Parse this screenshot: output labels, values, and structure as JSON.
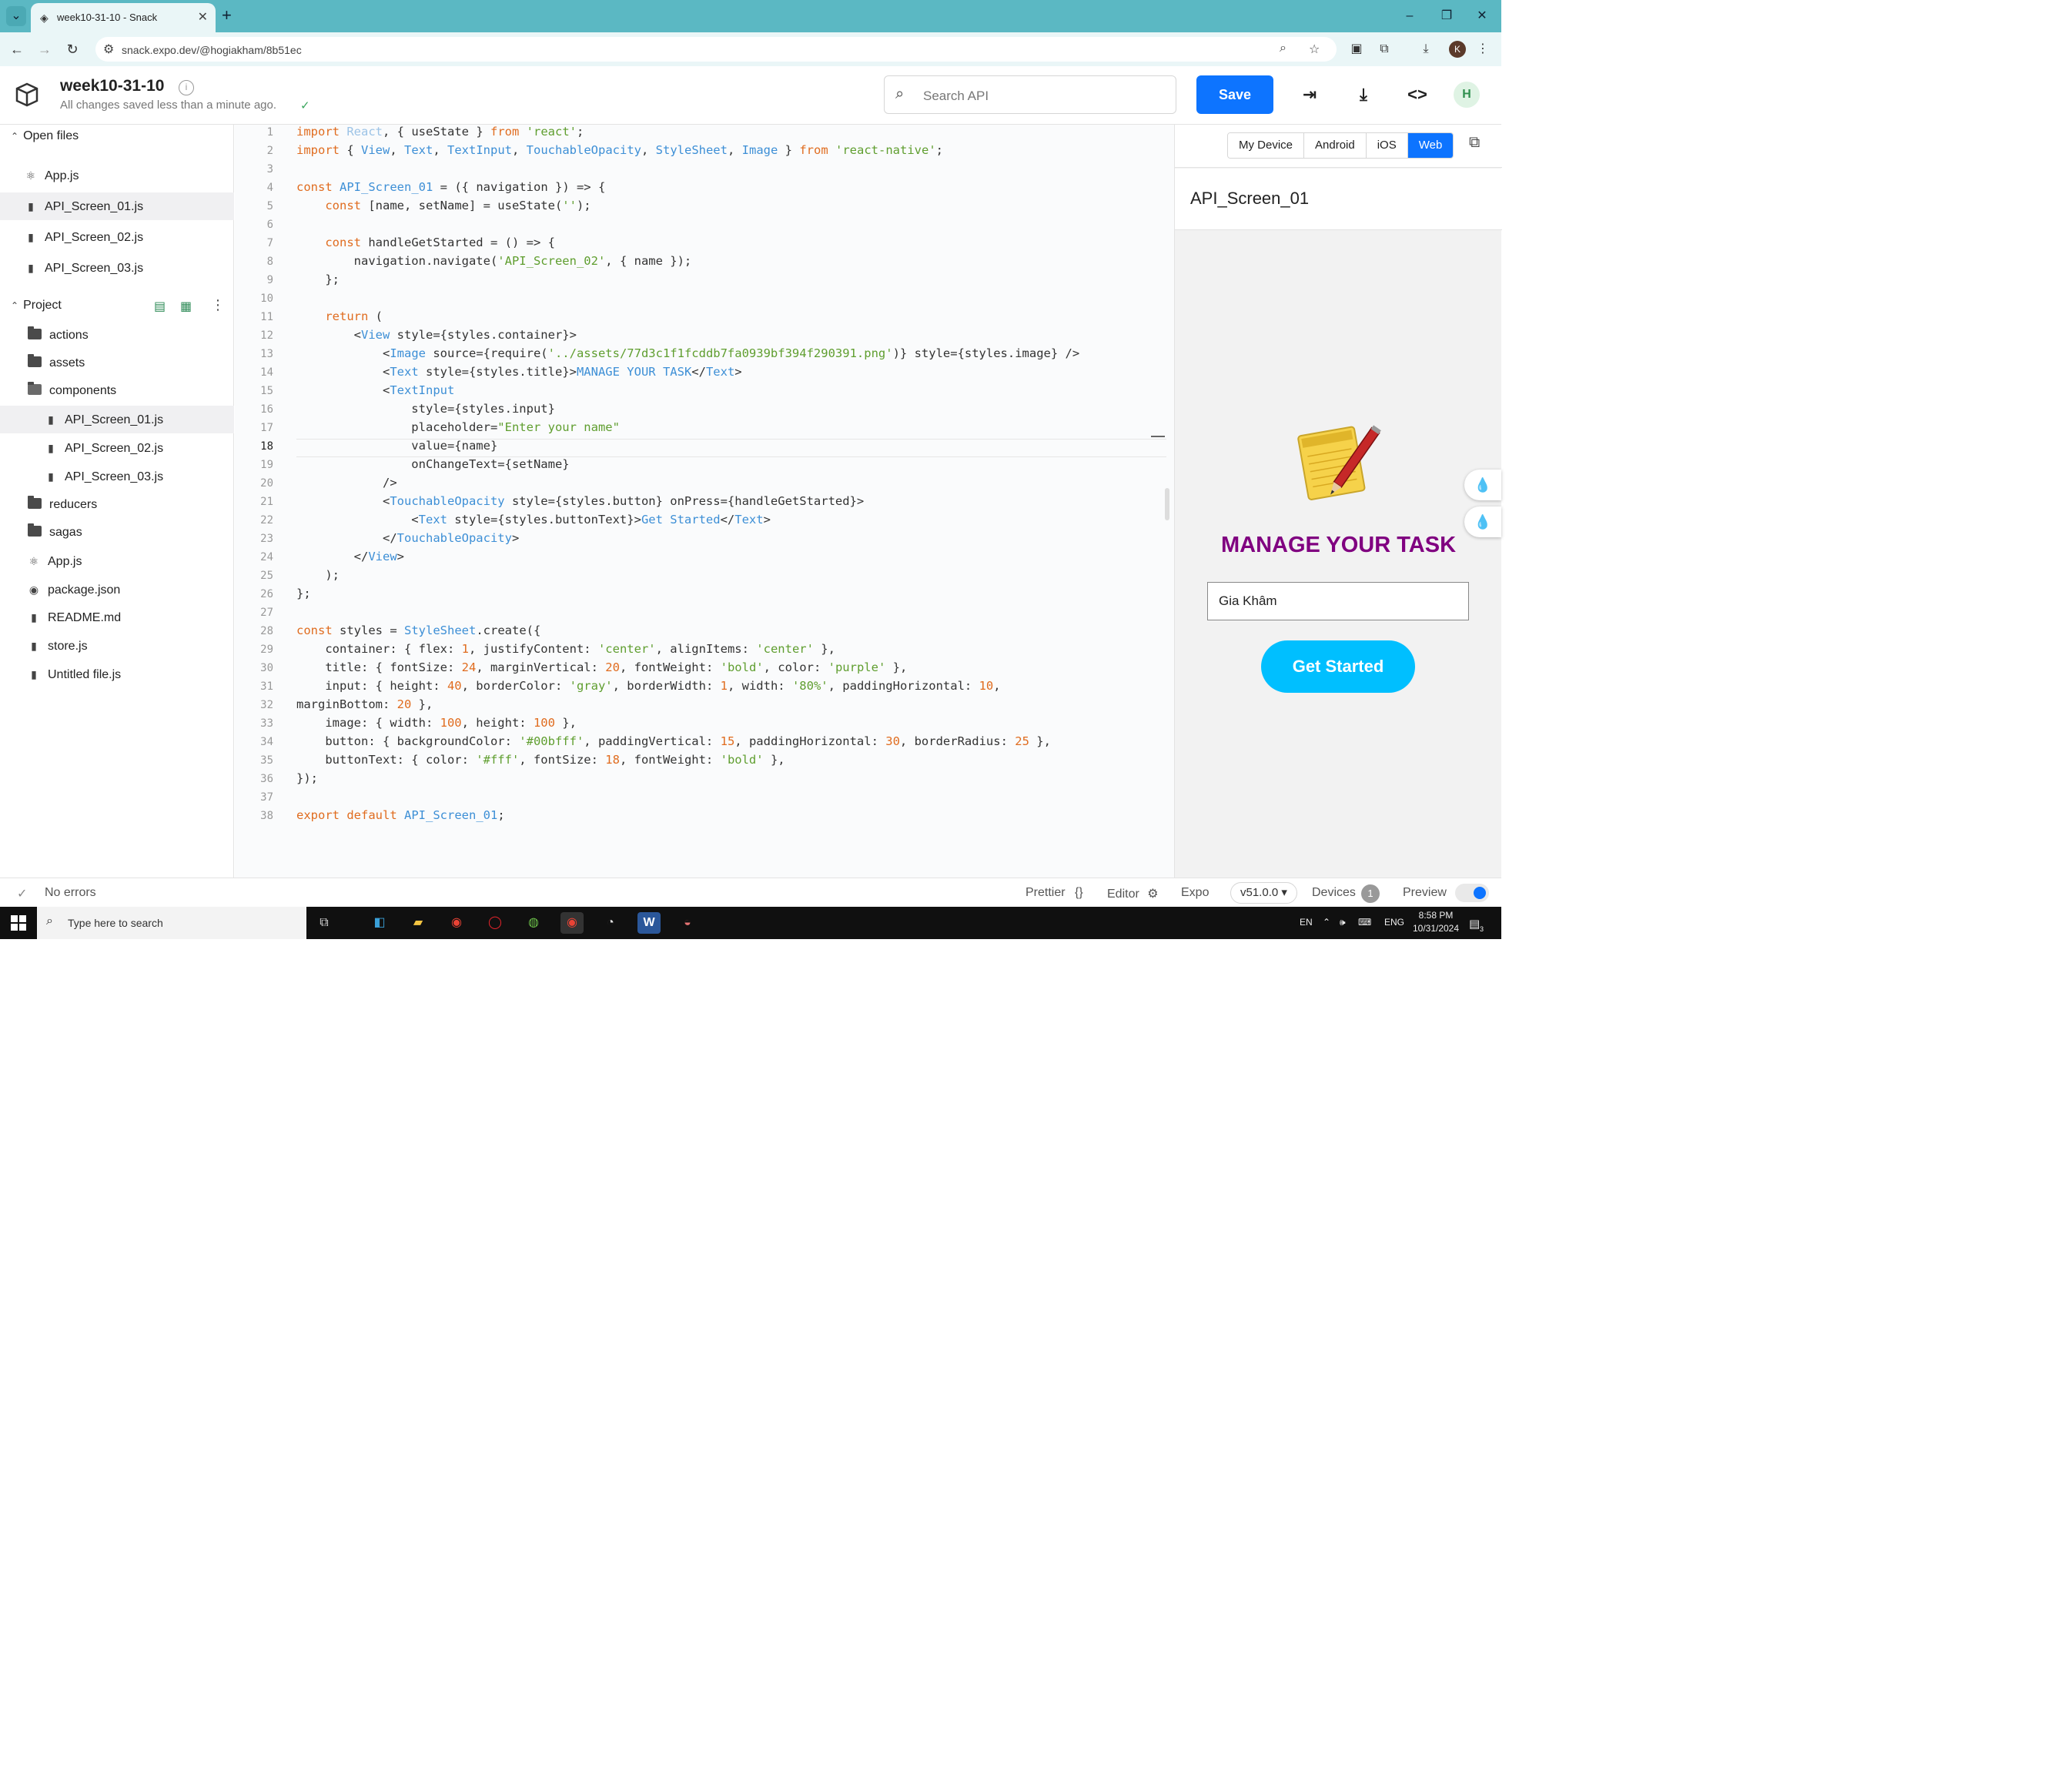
{
  "browser": {
    "tab_title": "week10-31-10 - Snack",
    "url": "snack.expo.dev/@hogiakham/8b51ec",
    "profile_initial": "K",
    "tab_strip_color": "#5bb8c3"
  },
  "header": {
    "project_title": "week10-31-10",
    "save_status": "All changes saved less than a minute ago.",
    "search_placeholder": "Search API",
    "save_label": "Save",
    "avatar_initial": "H",
    "accent_color": "#0d74ff"
  },
  "sidebar": {
    "open_files_label": "Open files",
    "open_files": [
      "App.js",
      "API_Screen_01.js",
      "API_Screen_02.js",
      "API_Screen_03.js"
    ],
    "project_label": "Project",
    "tree": {
      "actions": "actions",
      "assets": "assets",
      "components": "components",
      "comp_files": [
        "API_Screen_01.js",
        "API_Screen_02.js",
        "API_Screen_03.js"
      ],
      "reducers": "reducers",
      "sagas": "sagas",
      "root_files": [
        "App.js",
        "package.json",
        "README.md",
        "store.js",
        "Untitled file.js"
      ]
    }
  },
  "editor": {
    "current_line": 18,
    "line_count": 38
  },
  "preview": {
    "tabs": [
      "My Device",
      "Android",
      "iOS",
      "Web"
    ],
    "selected_tab": "Web",
    "screen_title": "API_Screen_01",
    "app_title": "MANAGE YOUR TASK",
    "input_value": "Gia Khâm",
    "button_label": "Get Started",
    "title_color": "#800080",
    "button_color": "#00bfff"
  },
  "statusbar": {
    "errors": "No errors",
    "prettier": "Prettier",
    "prettier_icon": "{}",
    "editor": "Editor",
    "expo": "Expo",
    "expo_version": "v51.0.0 ▾",
    "devices": "Devices",
    "devices_count": "1",
    "preview": "Preview"
  },
  "taskbar": {
    "search_text": "Type here to search",
    "lang": "EN",
    "lang2": "ENG",
    "time": "8:58 PM",
    "date": "10/31/2024",
    "notif_count": "3"
  }
}
